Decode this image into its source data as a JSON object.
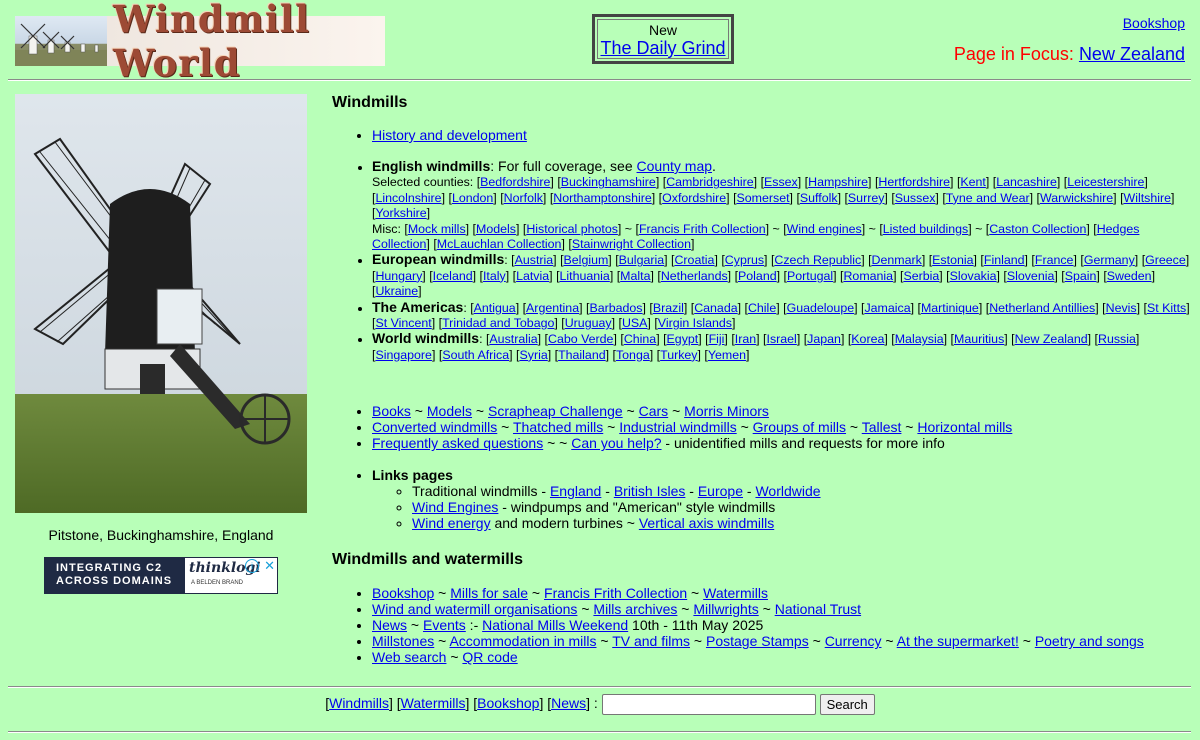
{
  "header": {
    "logo_text": "Windmill World",
    "new_label": "New",
    "daily_grind": "The Daily Grind",
    "bookshop": "Bookshop",
    "focus_label": "Page in Focus: ",
    "focus_link": "New Zealand"
  },
  "left": {
    "caption": "Pitstone, Buckinghamshire, England",
    "ad": {
      "line1": "INTEGRATING C2",
      "line2": "ACROSS DOMAINS",
      "brand": "thinklogi",
      "sub": "A BELDEN BRAND"
    }
  },
  "windmills": {
    "heading": "Windmills",
    "history": "History and development",
    "english": {
      "title": "English windmills",
      "coverage": ": For full coverage, see ",
      "county_map": "County map",
      "selected_label": "Selected counties: ",
      "counties": [
        "Bedfordshire",
        "Buckinghamshire",
        "Cambridgeshire",
        "Essex",
        "Hampshire",
        "Hertfordshire",
        "Kent",
        "Lancashire",
        "Leicestershire",
        "Lincolnshire",
        "London",
        "Norfolk",
        "Northamptonshire",
        "Oxfordshire",
        "Somerset",
        "Suffolk",
        "Surrey",
        "Sussex",
        "Tyne and Wear",
        "Warwickshire",
        "Wiltshire",
        "Yorkshire"
      ],
      "misc_label": "Misc: ",
      "misc_a": [
        "Mock mills",
        "Models",
        "Historical photos"
      ],
      "misc_b": [
        "Francis Frith Collection"
      ],
      "misc_c": [
        "Wind engines"
      ],
      "misc_d": [
        "Listed buildings"
      ],
      "misc_e": [
        "Caston Collection",
        "Hedges Collection",
        "McLauchlan Collection",
        "Stainwright Collection"
      ]
    },
    "european": {
      "title": "European windmills",
      "items": [
        "Austria",
        "Belgium",
        "Bulgaria",
        "Croatia",
        "Cyprus",
        "Czech Republic",
        "Denmark",
        "Estonia",
        "Finland",
        "France",
        "Germany",
        "Greece",
        "Hungary",
        "Iceland",
        "Italy",
        "Latvia",
        "Lithuania",
        "Malta",
        "Netherlands",
        "Poland",
        "Portugal",
        "Romania",
        "Serbia",
        "Slovakia",
        "Slovenia",
        "Spain",
        "Sweden",
        "Ukraine"
      ]
    },
    "americas": {
      "title": "The Americas",
      "items": [
        "Antigua",
        "Argentina",
        "Barbados",
        "Brazil",
        "Canada",
        "Chile",
        "Guadeloupe",
        "Jamaica",
        "Martinique",
        "Netherland Antillies",
        "Nevis",
        "St Kitts",
        "St Vincent",
        "Trinidad and Tobago",
        "Uruguay",
        "USA",
        "Virgin Islands"
      ]
    },
    "world": {
      "title": "World windmills",
      "items": [
        "Australia",
        "Cabo Verde",
        "China",
        "Egypt",
        "Fiji",
        "Iran",
        "Israel",
        "Japan",
        "Korea",
        "Malaysia",
        "Mauritius",
        "New Zealand",
        "Russia",
        "Singapore",
        "South Africa",
        "Syria",
        "Thailand",
        "Tonga",
        "Turkey",
        "Yemen"
      ]
    },
    "row1": [
      "Books",
      "Models",
      "Scrapheap Challenge",
      "Cars",
      "Morris Minors"
    ],
    "row2": [
      "Converted windmills",
      "Thatched mills",
      "Industrial windmills",
      "Groups of mills",
      "Tallest",
      "Horizontal mills"
    ],
    "faq": "Frequently asked questions",
    "help": "Can you help?",
    "help_note": " - unidentified mills and requests for more info",
    "links": {
      "title": "Links pages",
      "trad_label": "Traditional windmills - ",
      "trad": [
        "England",
        "British Isles",
        "Europe",
        "Worldwide"
      ],
      "wind_engines": "Wind Engines",
      "wind_engines_note": " - windpumps and \"American\" style windmills",
      "wind_energy": "Wind energy",
      "wind_energy_note": " and modern turbines ~ ",
      "vertical": "Vertical axis windmills"
    }
  },
  "watermills": {
    "heading": "Windmills and watermills",
    "row1": [
      "Bookshop",
      "Mills for sale",
      "Francis Frith Collection",
      "Watermills"
    ],
    "row2": [
      "Wind and watermill organisations",
      "Mills archives",
      "Millwrights",
      "National Trust"
    ],
    "news": "News",
    "events": "Events",
    "nmw": "National Mills Weekend",
    "nmw_date": " 10th - 11th May 2025",
    "row4": [
      "Millstones",
      "Accommodation in mills",
      "TV and films",
      "Postage Stamps",
      "Currency",
      "At the supermarket!",
      "Poetry and songs"
    ],
    "web_search": "Web search",
    "qr": "QR code"
  },
  "footer": {
    "links": [
      "Windmills",
      "Watermills",
      "Bookshop",
      "News"
    ],
    "search_button": "Search",
    "search_value": ""
  },
  "colors": {
    "background": "#b8ffb8",
    "link": "#0000ee",
    "focus": "#ff0000"
  }
}
